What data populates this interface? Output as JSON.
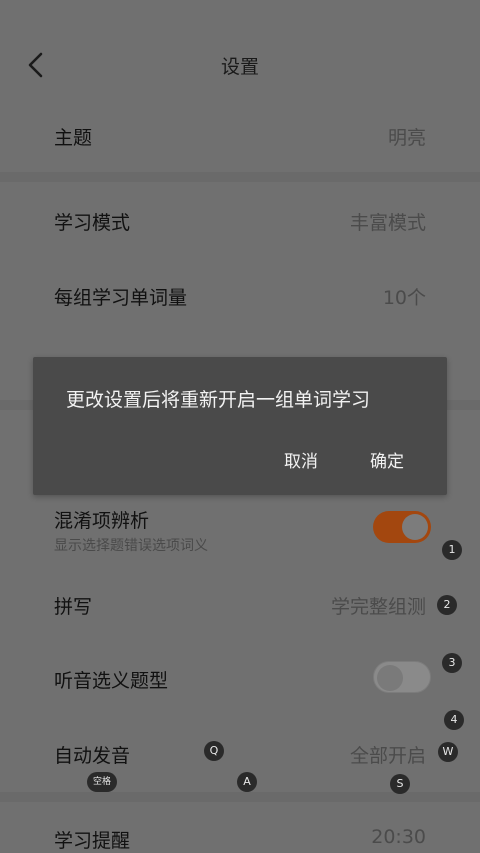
{
  "header": {
    "title": "设置",
    "back_icon": "chevron-left-icon"
  },
  "settings": {
    "theme": {
      "label": "主题",
      "value": "明亮"
    },
    "study_mode": {
      "label": "学习模式",
      "value": "丰富模式"
    },
    "words_per_group": {
      "label": "每组学习单词量",
      "value": "10个"
    },
    "confusion_analysis": {
      "label": "混淆项辨析",
      "subtitle": "显示选择题错误选项词义",
      "enabled": true
    },
    "spelling": {
      "label": "拼写",
      "value": "学完整组测"
    },
    "listening_question": {
      "label": "听音选义题型",
      "enabled": false
    },
    "auto_pronounce": {
      "label": "自动发音",
      "value": "全部开启"
    },
    "study_reminder": {
      "label": "学习提醒",
      "value": "20:30"
    }
  },
  "dialog": {
    "message": "更改设置后将重新开启一组单词学习",
    "cancel_label": "取消",
    "confirm_label": "确定"
  },
  "key_hints": {
    "k1": "1",
    "k2": "2",
    "k3": "3",
    "k4": "4",
    "kq": "Q",
    "kw": "W",
    "ka": "A",
    "ks": "S",
    "kspace": "空格"
  },
  "colors": {
    "toggle_on": "#a3470f",
    "dialog_bg": "#4a4a4a",
    "screen_bg": "#707070"
  }
}
